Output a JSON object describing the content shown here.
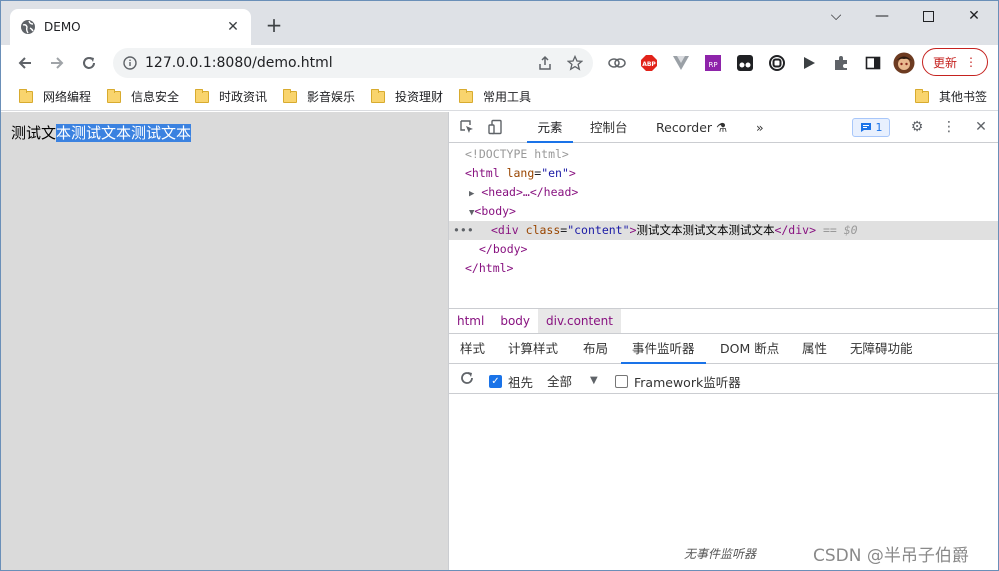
{
  "browser": {
    "tab_title": "DEMO",
    "url": "127.0.0.1:8080/demo.html",
    "update_label": "更新"
  },
  "bookmarks": [
    "网络编程",
    "信息安全",
    "时政资讯",
    "影音娱乐",
    "投资理财",
    "常用工具"
  ],
  "other_bookmarks": "其他书签",
  "page": {
    "text_unselected": "测试文",
    "text_selected": "本测试文本测试文本"
  },
  "devtools": {
    "tabs": {
      "elements": "元素",
      "console": "控制台",
      "recorder": "Recorder",
      "more": "»"
    },
    "issues_count": "1",
    "dom": {
      "doctype": "<!DOCTYPE html>",
      "html_open_tag": "<html",
      "html_attr": "lang",
      "html_val": "\"en\"",
      "head": "<head>…</head>",
      "body_open": "<body>",
      "div_open": "<div",
      "div_attr": "class",
      "div_val": "\"content\"",
      "div_text": "测试文本测试文本测试文本",
      "div_close": "</div>",
      "selected_marker": "== $0",
      "body_close": "</body>",
      "html_close": "</html>"
    },
    "breadcrumbs": [
      "html",
      "body",
      "div.content"
    ],
    "subtabs": [
      "样式",
      "计算样式",
      "布局",
      "事件监听器",
      "DOM 断点",
      "属性",
      "无障碍功能"
    ],
    "listeners": {
      "ancestors_label": "祖先",
      "filter_value": "全部",
      "framework_label": "Framework监听器",
      "empty": "无事件监听器"
    }
  },
  "watermark": "CSDN @半吊子伯爵",
  "colors": {
    "selection": "#3b82e0",
    "accent": "#1a73e8",
    "update_red": "#c5221f"
  }
}
